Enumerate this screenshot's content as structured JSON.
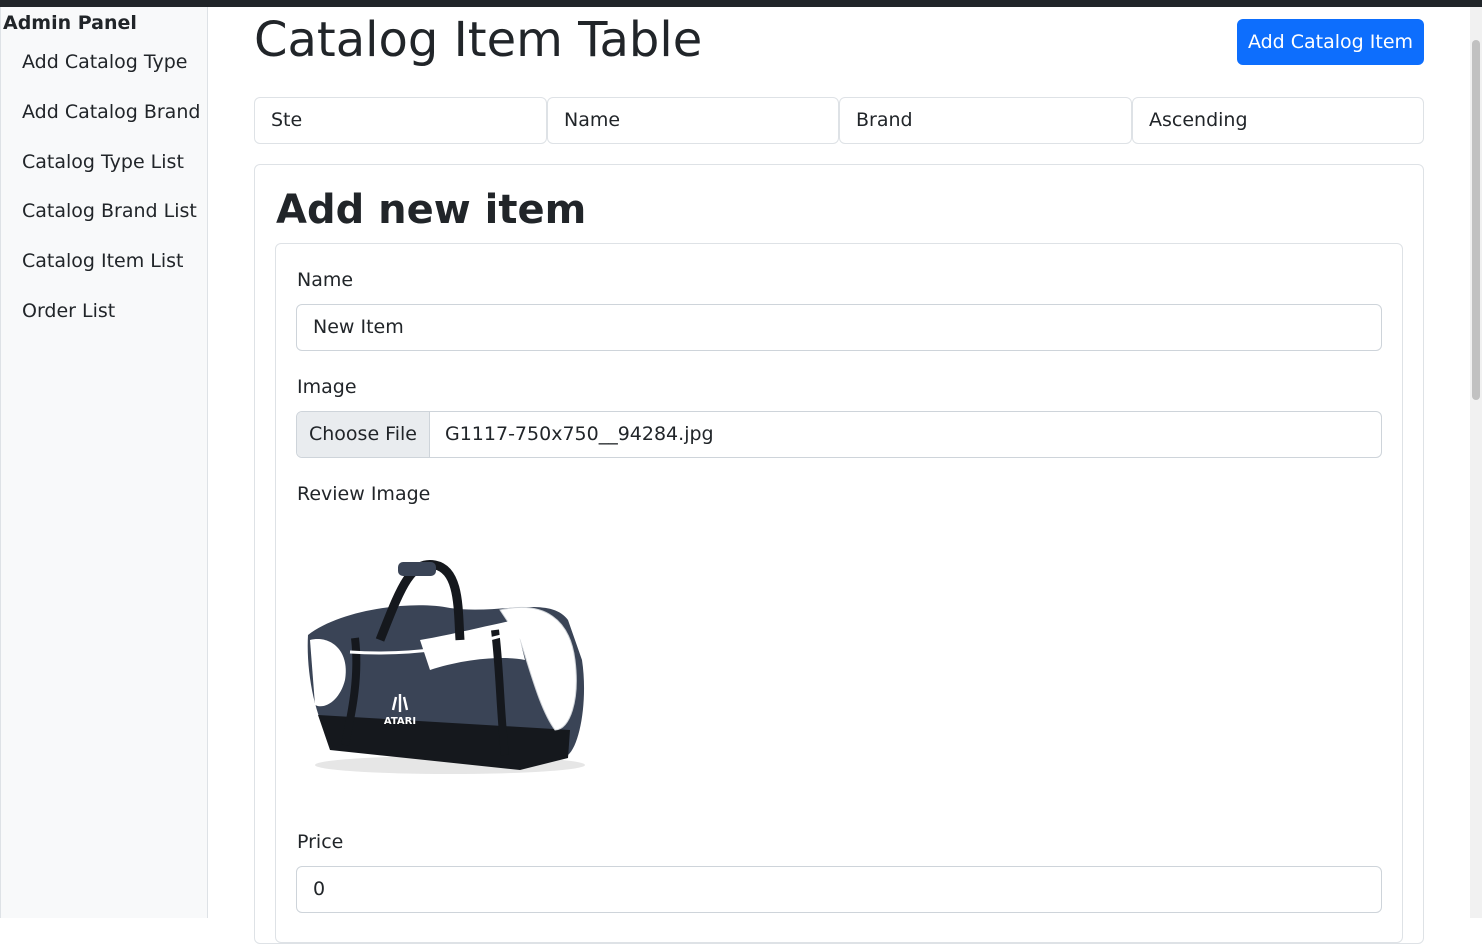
{
  "sidebar": {
    "brand": "Admin Panel",
    "items": [
      {
        "label": "Add Catalog Type"
      },
      {
        "label": "Add Catalog Brand"
      },
      {
        "label": "Catalog Type List"
      },
      {
        "label": "Catalog Brand List"
      },
      {
        "label": "Catalog Item List"
      },
      {
        "label": "Order List"
      }
    ]
  },
  "header": {
    "title": "Catalog Item Table",
    "add_button": "Add Catalog Item"
  },
  "filters": [
    "Ste",
    "Name",
    "Brand",
    "Ascending"
  ],
  "form": {
    "title": "Add new item",
    "name_label": "Name",
    "name_value": "New Item",
    "image_label": "Image",
    "choose_file": "Choose File",
    "file_name": "G1117-750x750__94284.jpg",
    "review_label": "Review Image",
    "logo_text": "ATARI",
    "price_label": "Price",
    "price_value": "0"
  },
  "colors": {
    "primary": "#0d6efd",
    "bag_navy": "#3a4456",
    "bag_black": "#15181d"
  }
}
